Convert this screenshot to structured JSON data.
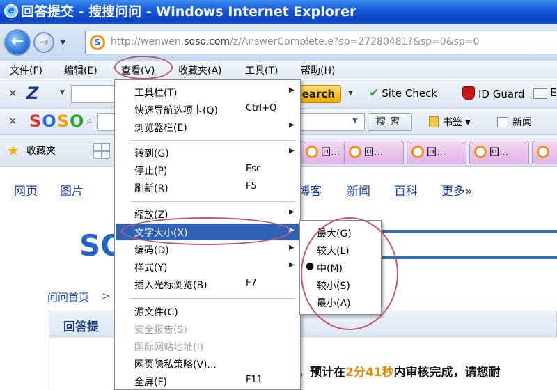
{
  "window": {
    "title": "回答提交 - 搜搜问问 - Windows Internet Explorer"
  },
  "address_bar": {
    "url_prefix": "http://wenwen.",
    "url_domain": "soso.com",
    "url_path": "/z/AnswerComplete.e?sp=27280481?&sp=0&sp=0"
  },
  "menubar": [
    "文件(F)",
    "编辑(E)",
    "查看(V)",
    "收藏夹(A)",
    "工具(T)",
    "帮助(H)"
  ],
  "zoo_toolbar": {
    "logo": "Z",
    "search_label": "Search",
    "site_check": "Site Check",
    "id_guard": "ID Guard",
    "mail_label": "E"
  },
  "soso_toolbar": {
    "search_button": "搜索",
    "bookmark": "书签",
    "news": "新闻"
  },
  "favorites_bar": {
    "label": "收藏夹",
    "tab_label": "回..."
  },
  "view_menu": {
    "items": [
      {
        "label": "工具栏(T)",
        "shortcut": ""
      },
      {
        "label": "快速导航选项卡(Q)",
        "shortcut": "Ctrl+Q"
      },
      {
        "label": "浏览器栏(E)",
        "shortcut": ""
      },
      {
        "label": "转到(G)",
        "shortcut": ""
      },
      {
        "label": "停止(P)",
        "shortcut": "Esc"
      },
      {
        "label": "刷新(R)",
        "shortcut": "F5"
      },
      {
        "label": "缩放(Z)",
        "shortcut": ""
      },
      {
        "label": "文字大小(X)",
        "shortcut": ""
      },
      {
        "label": "编码(D)",
        "shortcut": ""
      },
      {
        "label": "样式(Y)",
        "shortcut": ""
      },
      {
        "label": "插入光标浏览(B)",
        "shortcut": "F7"
      },
      {
        "label": "源文件(C)",
        "shortcut": ""
      },
      {
        "label": "安全报告(S)",
        "shortcut": ""
      },
      {
        "label": "国际网站地址(I)",
        "shortcut": ""
      },
      {
        "label": "网页隐私策略(V)...",
        "shortcut": ""
      },
      {
        "label": "全屏(F)",
        "shortcut": "F11"
      }
    ]
  },
  "text_size_menu": {
    "items": [
      {
        "label": "最大(G)"
      },
      {
        "label": "较大(L)"
      },
      {
        "label": "中(M)",
        "selected": true
      },
      {
        "label": "较小(S)"
      },
      {
        "label": "最小(A)"
      }
    ],
    "bullet": "●"
  },
  "page": {
    "nav": [
      "网页",
      "图片",
      "博客",
      "新闻",
      "百科",
      "更多»"
    ],
    "logo": "SO",
    "breadcrumb": "问问首页",
    "answer_title": "回答提",
    "review_prefix": "，预计在",
    "review_time": "2分41秒",
    "review_suffix": "内审核完成，请您耐"
  },
  "colors": {
    "titlebar": "#1656d8",
    "menu_highlight": "#2f61b6",
    "annotation_circle": "#c05a6a",
    "link": "#1a3f9c",
    "time_highlight": "#e08a00"
  }
}
